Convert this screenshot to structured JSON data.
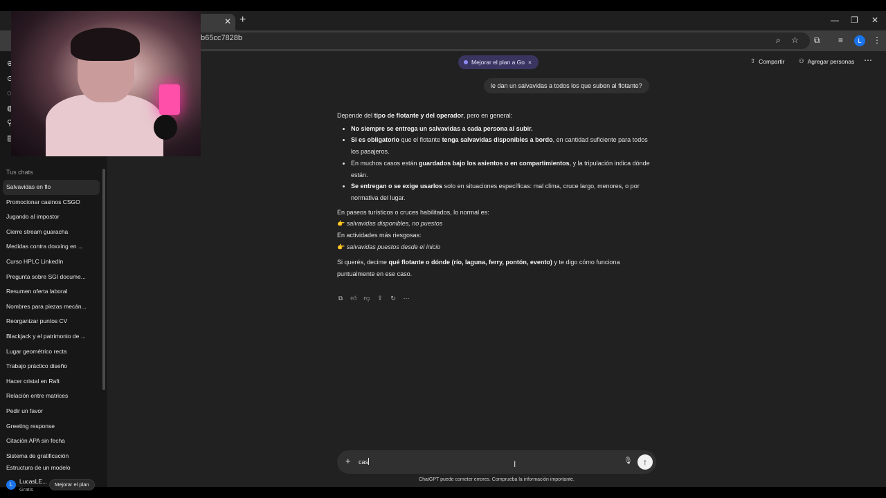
{
  "browser": {
    "url_fragment": "b65cc7828b",
    "profile_initial": "L"
  },
  "sidebar": {
    "section_title": "Tus chats",
    "chats": [
      "Salvavidas en flo",
      "Promocionar casinos CSGO",
      "Jugando al impostor",
      "Cierre stream guaracha",
      "Medidas contra doxxing en ...",
      "Curso HPLC LinkedIn",
      "Pregunta sobre SGI docume...",
      "Resumen oferta laboral",
      "Nombres para piezas mecán...",
      "Reorganizar puntos CV",
      "Blackjack y el patrimonio de ...",
      "Lugar geométrico recta",
      "Trabajo práctico diseño",
      "Hacer cristal en Raft",
      "Relación entre matrices",
      "Pedir un favor",
      "Greeting response",
      "Citación APA sin fecha",
      "Sistema de gratificación",
      "Estructura de un modelo"
    ],
    "user": {
      "name": "LucasLE...",
      "plan": "Gratis",
      "initial": "L",
      "upgrade_label": "Mejorar el plan"
    }
  },
  "header": {
    "upgrade_pill": "Mejorar el plan a Go",
    "upgrade_close": "×",
    "share_label": "Compartir",
    "add_people_label": "Agregar personas"
  },
  "conversation": {
    "user_message": "le dan un salvavidas a todos los que suben al flotante?"
  },
  "composer": {
    "input_value": "cas",
    "disclaimer": "ChatGPT puede cometer errores. Comprueba la información importante."
  },
  "colors": {
    "background": "#212121",
    "sidebar": "#171717",
    "accent_pill": "#3a3560"
  }
}
